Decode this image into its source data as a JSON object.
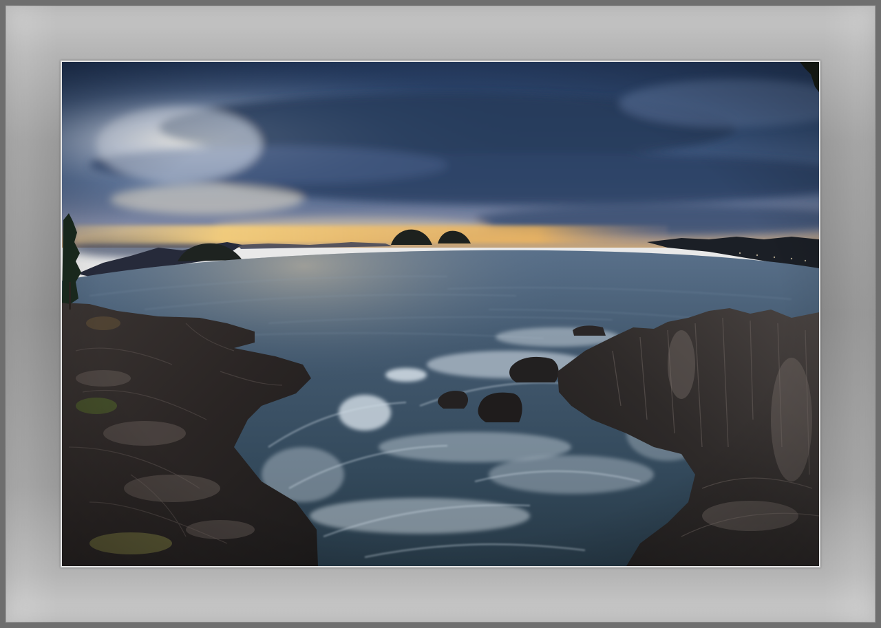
{
  "image": {
    "subject": "seascape",
    "colors": {
      "outer_border": "#6e6e6e",
      "mat_light": "#c9c9c9",
      "mat_dark": "#8a8a8a",
      "photo_edge": "#e9e9e9",
      "sky_top": "#2f4a6f",
      "sky_mid": "#4d6a92",
      "sunset_glow": "#f3c66a",
      "sea": "#3d5163",
      "rocks": "#2a2727"
    }
  }
}
